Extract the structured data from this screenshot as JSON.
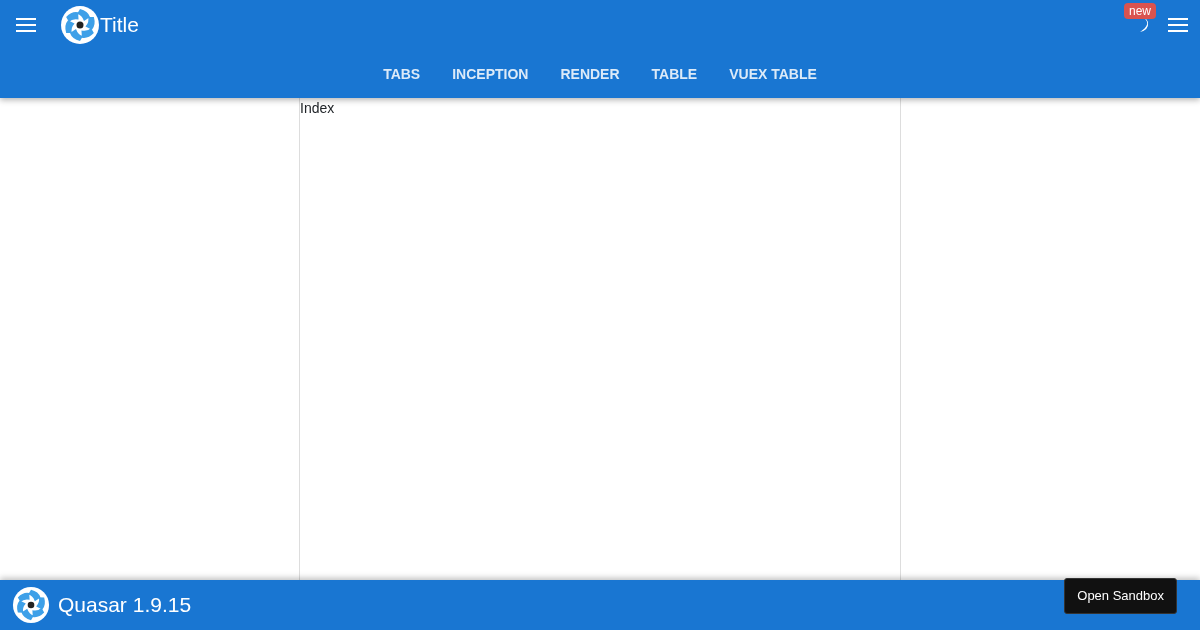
{
  "header": {
    "title": "Title",
    "badge": "new"
  },
  "tabs": [
    {
      "label": "TABS"
    },
    {
      "label": "INCEPTION"
    },
    {
      "label": "RENDER"
    },
    {
      "label": "TABLE"
    },
    {
      "label": "VUEX TABLE"
    }
  ],
  "page": {
    "text": "Index"
  },
  "footer": {
    "title": "Quasar 1.9.15"
  },
  "sandbox_button": "Open Sandbox"
}
